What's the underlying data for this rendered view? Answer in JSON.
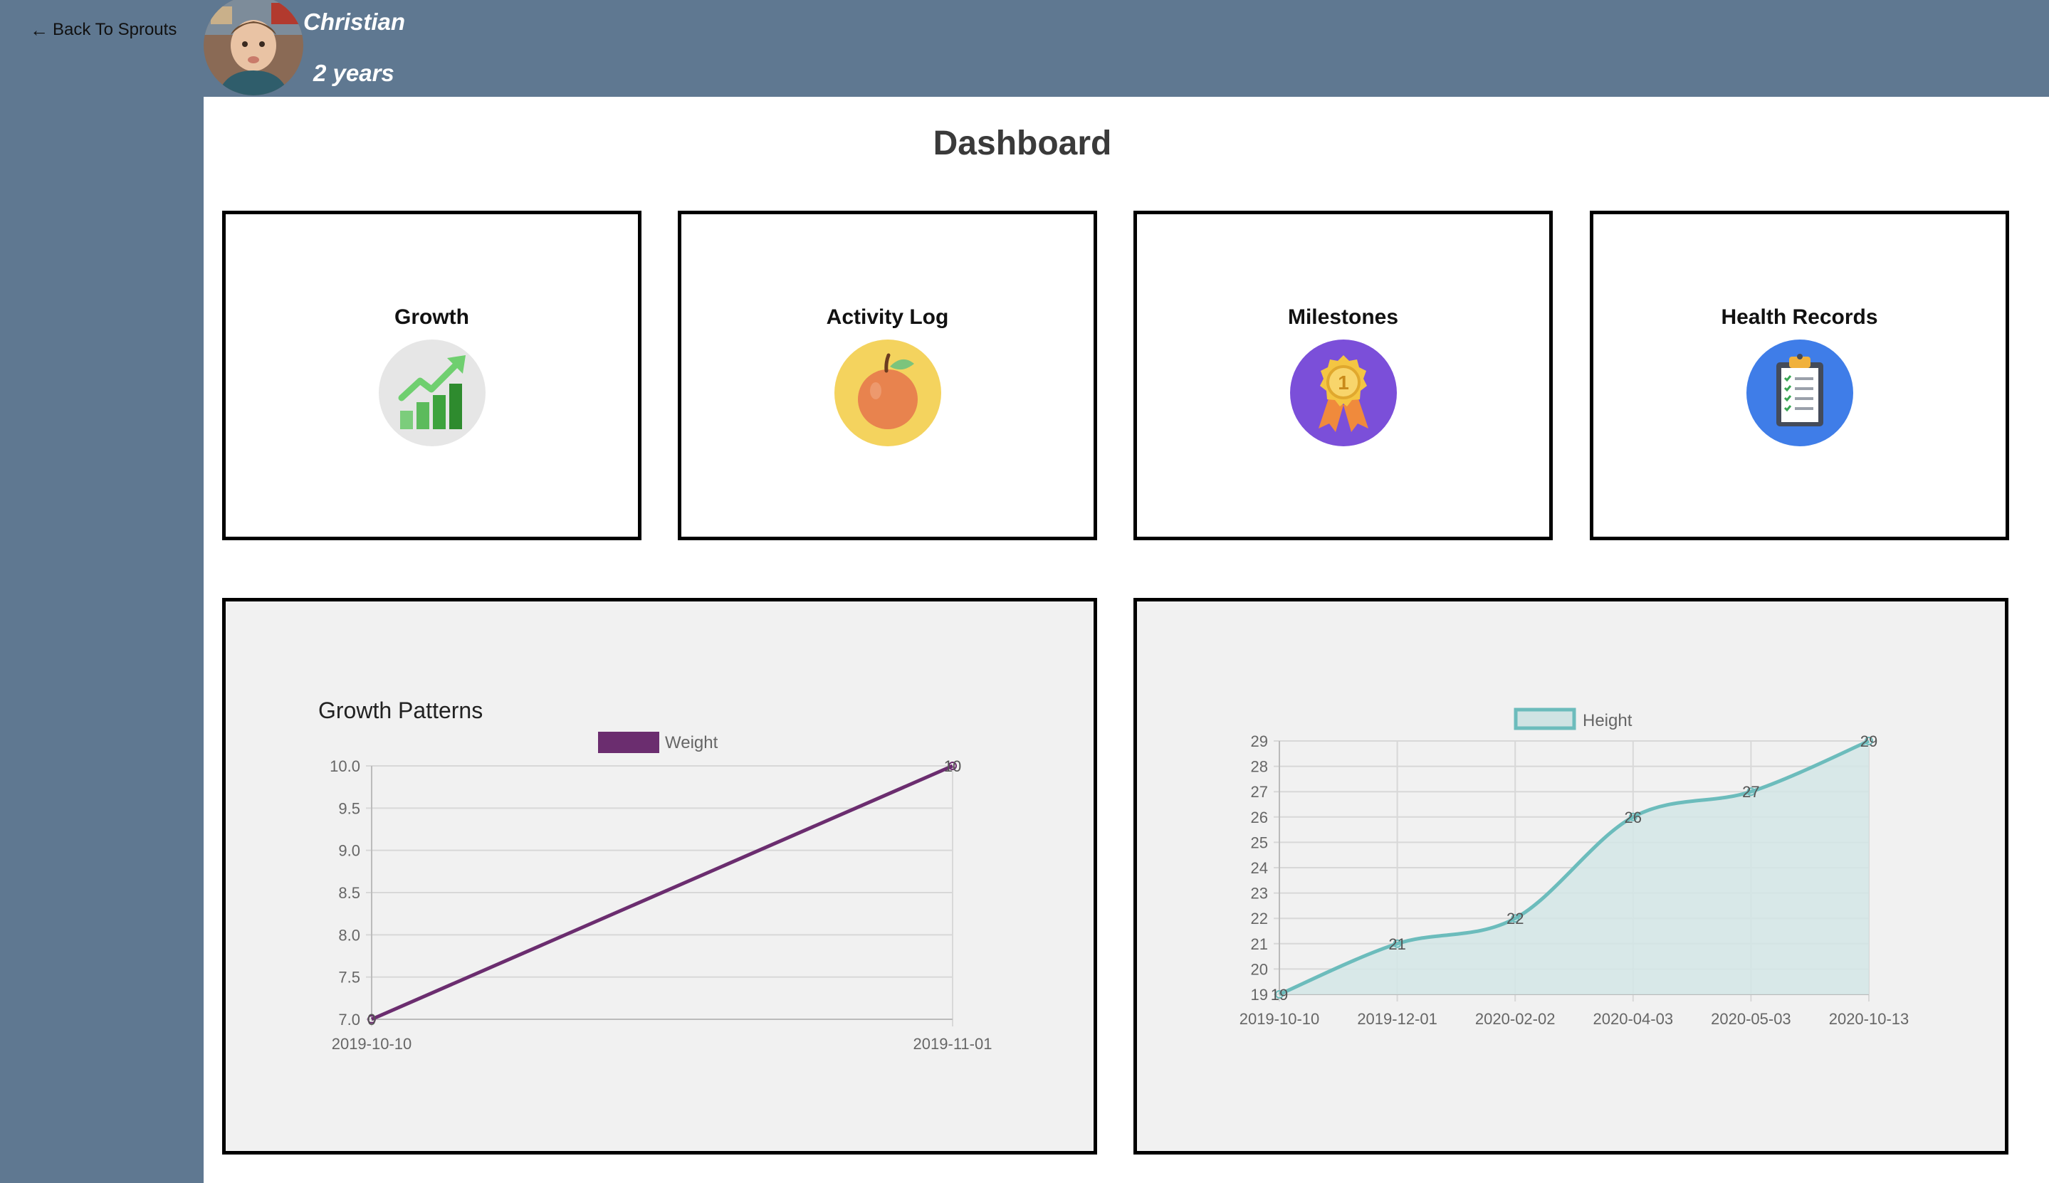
{
  "nav": {
    "back_label": "Back To Sprouts"
  },
  "profile": {
    "name": "Christian",
    "age": "2 years"
  },
  "dashboard": {
    "title": "Dashboard",
    "cards": [
      {
        "label": "Growth",
        "icon": "growth-chart-icon"
      },
      {
        "label": "Activity Log",
        "icon": "apple-icon"
      },
      {
        "label": "Milestones",
        "icon": "medal-icon"
      },
      {
        "label": "Health Records",
        "icon": "clipboard-icon"
      }
    ]
  },
  "colors": {
    "sidebar": "#5f7891",
    "weight_series": "#6b2d6f",
    "height_series": "#6cbcbc",
    "height_fill": "#d4e6e6",
    "panel_bg": "#f1f1f1"
  },
  "chart_data": [
    {
      "type": "line",
      "title": "Growth Patterns",
      "x": [
        "2019-10-10",
        "2019-11-01"
      ],
      "series": [
        {
          "name": "Weight",
          "values": [
            7,
            10
          ]
        }
      ],
      "y_ticks": [
        "10.0",
        "9.5",
        "9.0",
        "8.5",
        "8.0",
        "7.5",
        "7.0"
      ],
      "ylim": [
        7,
        10
      ],
      "point_labels": [
        "0",
        "10"
      ],
      "grid": true,
      "legend": "top-center"
    },
    {
      "type": "area",
      "title": "",
      "x": [
        "2019-10-10",
        "2019-12-01",
        "2020-02-02",
        "2020-04-03",
        "2020-05-03",
        "2020-10-13"
      ],
      "series": [
        {
          "name": "Height",
          "values": [
            19,
            21,
            22,
            26,
            27,
            29
          ]
        }
      ],
      "y_ticks": [
        "29",
        "28",
        "27",
        "26",
        "25",
        "24",
        "23",
        "22",
        "21",
        "20",
        "19"
      ],
      "ylim": [
        19,
        29
      ],
      "point_labels": [
        "19",
        "21",
        "22",
        "26",
        "27",
        "29"
      ],
      "grid": true,
      "legend": "top-center"
    }
  ]
}
